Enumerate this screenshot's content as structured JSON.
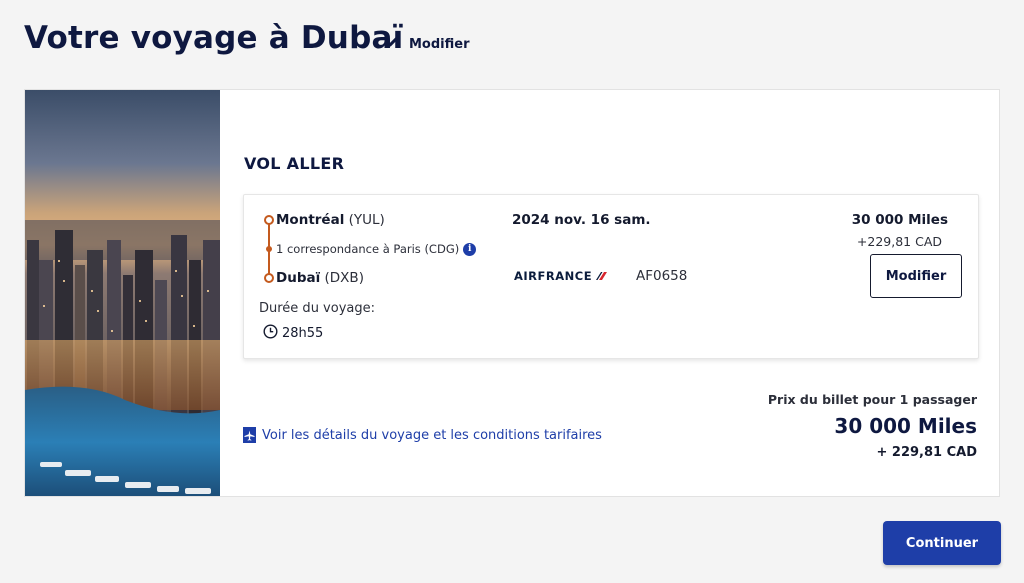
{
  "header": {
    "title": "Votre voyage à Dubaï",
    "edit_label": "Modifier"
  },
  "trip": {
    "section_title": "VOL ALLER",
    "origin_city": "Montréal",
    "origin_code": "(YUL)",
    "connection": "1 correspondance à Paris (CDG)",
    "destination_city": "Dubaï",
    "destination_code": "(DXB)",
    "duration_label": "Durée du voyage:",
    "duration": "28h55",
    "date": "2024 nov. 16 sam.",
    "airline": "AIRFRANCE",
    "flight_number": "AF0658",
    "miles": "30 000  Miles",
    "tax": "+229,81 CAD",
    "modify_label": "Modifier"
  },
  "footer": {
    "details_link": "Voir les détails du voyage et les conditions tarifaires",
    "price_label": "Prix du billet pour 1 passager",
    "price_miles": "30 000  Miles",
    "price_tax": "+ 229,81 CAD",
    "continue_label": "Continuer"
  },
  "colors": {
    "brand_blue": "#1e3ea8",
    "navy": "#0e1840",
    "route_orange": "#c45a1e",
    "background": "#f4f4f4"
  }
}
